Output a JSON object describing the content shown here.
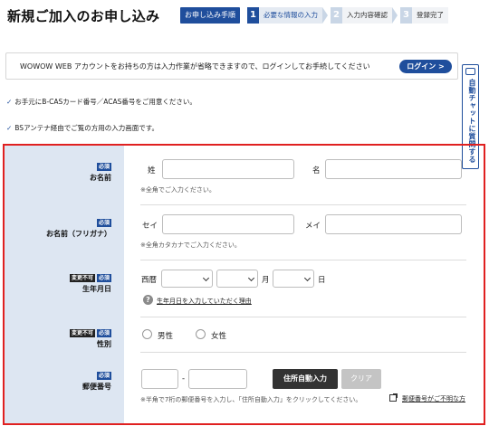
{
  "page": {
    "title": "新規ご加入のお申し込み"
  },
  "steps": {
    "guide_label": "お申し込み手順",
    "items": [
      {
        "num": "1",
        "label": "必要な情報の入力",
        "state": "active"
      },
      {
        "num": "2",
        "label": "入力内容確認",
        "state": "inactive"
      },
      {
        "num": "3",
        "label": "登録完了",
        "state": "inactive"
      }
    ]
  },
  "login": {
    "message": "WOWOW WEB アカウントをお持ちの方は入力作業が省略できますので、ログインしてお手続してください",
    "button": "ログイン >"
  },
  "side_chat": {
    "label": "自動チャットに質問する",
    "icon": "chat-icon"
  },
  "notes": [
    {
      "icon": "check-icon",
      "check": "✓",
      "text": "お手元にB-CASカード番号／ACAS番号をご用意ください。"
    },
    {
      "icon": "check-icon",
      "check": "✓",
      "text": "BSアンテナ経由でご覧の方用の入力画面です。"
    }
  ],
  "badges": {
    "required": "必須",
    "fixed": "変更不可"
  },
  "form": {
    "name": {
      "label": "お名前",
      "last_label": "姓",
      "last_value": "",
      "first_label": "名",
      "first_value": "",
      "hint": "※全角でご入力ください。"
    },
    "kana": {
      "label": "お名前（フリガナ）",
      "last_label": "セイ",
      "last_value": "",
      "first_label": "メイ",
      "first_value": "",
      "hint": "※全角カタカナでご入力ください。"
    },
    "birth": {
      "label": "生年月日",
      "era_label": "西暦",
      "year_value": "",
      "month_value": "",
      "day_value": "",
      "month_unit": "月",
      "day_unit": "日",
      "help_link": "生年月日を入力していただく理由",
      "help_icon_char": "?"
    },
    "gender": {
      "label": "性別",
      "options": [
        "男性",
        "女性"
      ]
    },
    "postal": {
      "label": "郵便番号",
      "part1_value": "",
      "separator": "-",
      "part2_value": "",
      "auto_button": "住所自動入力",
      "clear_button": "クリア",
      "hint": "※半角で7桁の郵便番号を入力し、「住所自動入力」をクリックしてください。",
      "unknown_link": "郵便番号がご不明な方"
    }
  },
  "colors": {
    "accent": "#1f4e9c",
    "frame": "#e02020",
    "label_bg": "#dde6f2"
  }
}
